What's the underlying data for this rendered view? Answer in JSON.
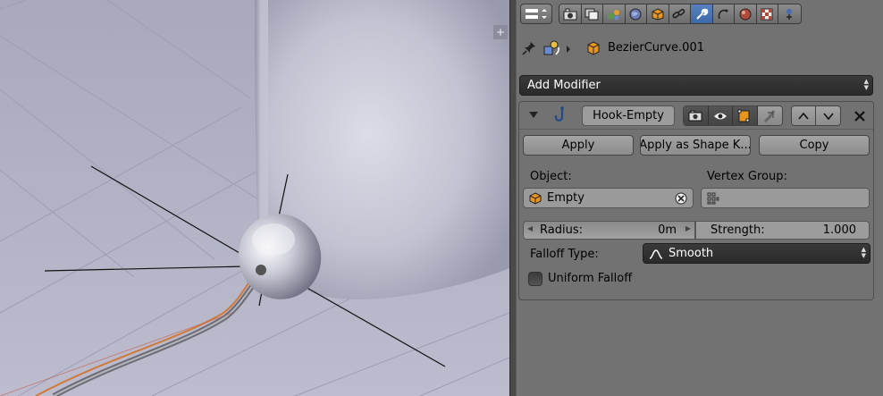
{
  "header": {
    "editor_icon": "properties-editor-icon",
    "tabs": [
      {
        "name": "render-tab",
        "icon": "camera-icon",
        "active": false
      },
      {
        "name": "render-layers-tab",
        "icon": "render-layers-icon",
        "active": false
      },
      {
        "name": "scene-tab",
        "icon": "scene-icon",
        "active": false
      },
      {
        "name": "world-tab",
        "icon": "world-icon",
        "active": false
      },
      {
        "name": "object-tab",
        "icon": "object-cube-icon",
        "active": false
      },
      {
        "name": "constraints-tab",
        "icon": "constraints-chain-icon",
        "active": false
      },
      {
        "name": "modifiers-tab",
        "icon": "wrench-icon",
        "active": true
      },
      {
        "name": "data-tab",
        "icon": "curve-data-icon",
        "active": false
      },
      {
        "name": "material-tab",
        "icon": "material-sphere-icon",
        "active": false
      },
      {
        "name": "texture-tab",
        "icon": "texture-checker-icon",
        "active": false
      },
      {
        "name": "physics-tab",
        "icon": "physics-icon",
        "active": false
      }
    ]
  },
  "context": {
    "pin_icon": "pin-icon",
    "object_name": "BezierCurve.001"
  },
  "add_modifier": {
    "label": "Add Modifier"
  },
  "modifier": {
    "name": "Hook-Empty",
    "buttons": {
      "apply": "Apply",
      "apply_shape": "Apply as Shape K...",
      "copy": "Copy"
    },
    "object_label": "Object:",
    "object_value": "Empty",
    "vertex_group_label": "Vertex Group:",
    "vertex_group_value": "",
    "radius_label": "Radius:",
    "radius_value": "0m",
    "strength_label": "Strength:",
    "strength_value": "1.000",
    "falloff_label": "Falloff Type:",
    "falloff_value": "Smooth",
    "uniform_falloff_label": "Uniform Falloff",
    "uniform_falloff_checked": false
  },
  "colors": {
    "active_tab": "#5680c2",
    "panel_bg": "#727272",
    "viewport_bg": "#b8b8cc",
    "dark_button": "#2e2e2e"
  }
}
